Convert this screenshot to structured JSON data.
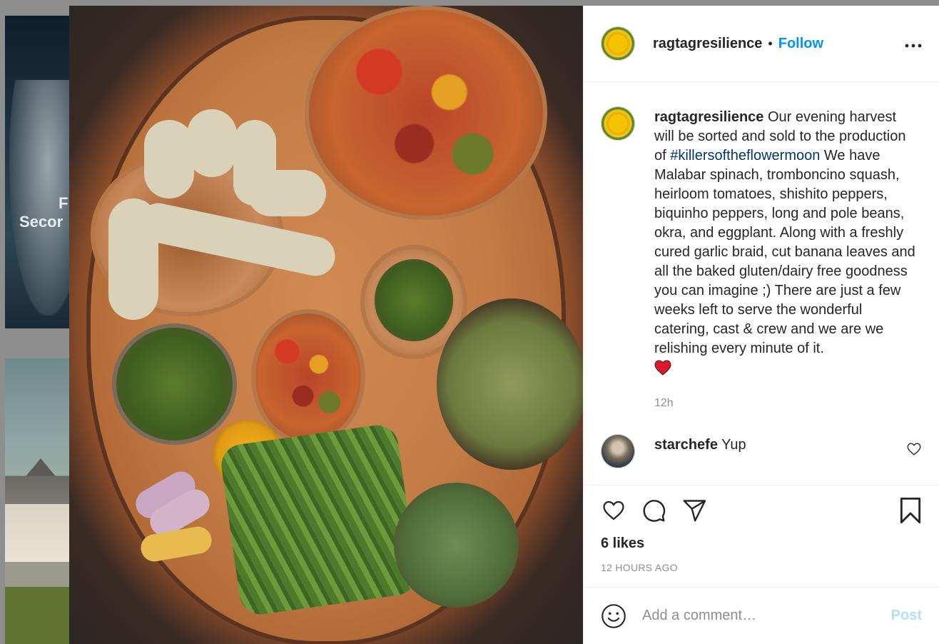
{
  "background_feed": {
    "card_text_line1": "F",
    "card_text_line2": "Secor"
  },
  "post": {
    "author": {
      "username": "ragtagresilience",
      "avatar_icon": "sunflower-avatar"
    },
    "follow_label": "Follow",
    "separator": "•",
    "more_label": "•••",
    "caption": {
      "username": "ragtagresilience",
      "text_before_hashtag": "Our evening harvest will be sorted and sold to the production of ",
      "hashtag": "#killersoftheflowermoon",
      "text_after_hashtag": " We have Malabar spinach, tromboncino squash, heirloom tomatoes, shishito peppers, biquinho peppers, long and pole beans, okra, and eggplant. Along with a freshly cured garlic braid, cut banana leaves and all the baked gluten/dairy free goodness you can imagine ;) There are just a few weeks left to serve the wonderful catering, cast & crew and we are we relishing every minute of it.",
      "emoji": "❤️",
      "time": "12h"
    },
    "comments": [
      {
        "username": "starchefe",
        "text": "Yup"
      }
    ],
    "likes": "6 likes",
    "timestamp": "12 HOURS AGO",
    "add_comment": {
      "placeholder": "Add a comment…",
      "post_label": "Post"
    },
    "colors": {
      "link_blue": "#0095f6",
      "hashtag_blue": "#00376b",
      "post_disabled": "#b2dffc",
      "muted": "#8e8e8e",
      "heart_red": "#e0152e"
    }
  }
}
